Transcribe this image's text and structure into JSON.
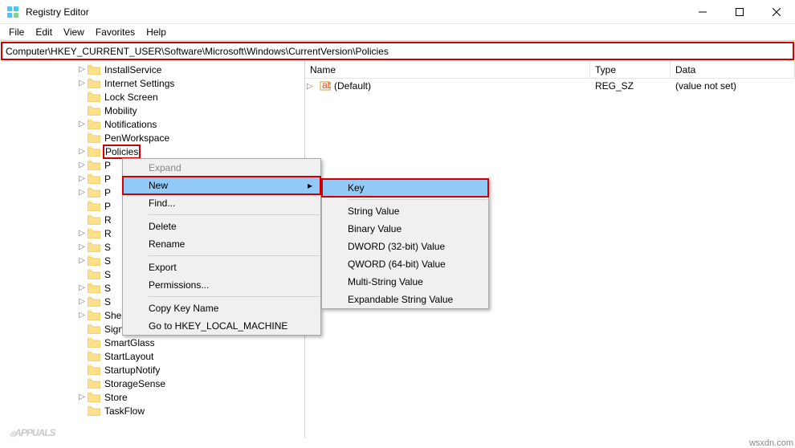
{
  "window": {
    "title": "Registry Editor"
  },
  "menu": [
    "File",
    "Edit",
    "View",
    "Favorites",
    "Help"
  ],
  "address": "Computer\\HKEY_CURRENT_USER\\Software\\Microsoft\\Windows\\CurrentVersion\\Policies",
  "tree": [
    {
      "indent": 95,
      "exp": ">",
      "label": "InstallService"
    },
    {
      "indent": 95,
      "exp": ">",
      "label": "Internet Settings"
    },
    {
      "indent": 95,
      "exp": "",
      "label": "Lock Screen"
    },
    {
      "indent": 95,
      "exp": "",
      "label": "Mobility"
    },
    {
      "indent": 95,
      "exp": ">",
      "label": "Notifications"
    },
    {
      "indent": 95,
      "exp": "",
      "label": "PenWorkspace"
    },
    {
      "indent": 95,
      "exp": ">",
      "label": "Policies",
      "hl": true
    },
    {
      "indent": 95,
      "exp": ">",
      "label": "P"
    },
    {
      "indent": 95,
      "exp": ">",
      "label": "P"
    },
    {
      "indent": 95,
      "exp": ">",
      "label": "P"
    },
    {
      "indent": 95,
      "exp": "",
      "label": "P"
    },
    {
      "indent": 95,
      "exp": "",
      "label": "R"
    },
    {
      "indent": 95,
      "exp": ">",
      "label": "R"
    },
    {
      "indent": 95,
      "exp": ">",
      "label": "S"
    },
    {
      "indent": 95,
      "exp": ">",
      "label": "S"
    },
    {
      "indent": 95,
      "exp": "",
      "label": "S"
    },
    {
      "indent": 95,
      "exp": ">",
      "label": "S"
    },
    {
      "indent": 95,
      "exp": ">",
      "label": "S"
    },
    {
      "indent": 95,
      "exp": ">",
      "label": "Shell Extensions"
    },
    {
      "indent": 95,
      "exp": "",
      "label": "SignalManager"
    },
    {
      "indent": 95,
      "exp": "",
      "label": "SmartGlass"
    },
    {
      "indent": 95,
      "exp": "",
      "label": "StartLayout"
    },
    {
      "indent": 95,
      "exp": "",
      "label": "StartupNotify"
    },
    {
      "indent": 95,
      "exp": "",
      "label": "StorageSense"
    },
    {
      "indent": 95,
      "exp": ">",
      "label": "Store"
    },
    {
      "indent": 95,
      "exp": "",
      "label": "TaskFlow"
    }
  ],
  "columns": {
    "name": "Name",
    "type": "Type",
    "data": "Data"
  },
  "values": [
    {
      "name": "(Default)",
      "type": "REG_SZ",
      "data": "(value not set)"
    }
  ],
  "context1": [
    {
      "label": "Expand",
      "kind": "dis"
    },
    {
      "label": "New",
      "kind": "sel hl",
      "arrow": true
    },
    {
      "label": "Find...",
      "kind": ""
    },
    {
      "sep": true
    },
    {
      "label": "Delete",
      "kind": ""
    },
    {
      "label": "Rename",
      "kind": ""
    },
    {
      "sep": true
    },
    {
      "label": "Export",
      "kind": ""
    },
    {
      "label": "Permissions...",
      "kind": ""
    },
    {
      "sep": true
    },
    {
      "label": "Copy Key Name",
      "kind": ""
    },
    {
      "label": "Go to HKEY_LOCAL_MACHINE",
      "kind": ""
    }
  ],
  "context2": [
    {
      "label": "Key",
      "kind": "sel hl"
    },
    {
      "sep": true
    },
    {
      "label": "String Value",
      "kind": ""
    },
    {
      "label": "Binary Value",
      "kind": ""
    },
    {
      "label": "DWORD (32-bit) Value",
      "kind": ""
    },
    {
      "label": "QWORD (64-bit) Value",
      "kind": ""
    },
    {
      "label": "Multi-String Value",
      "kind": ""
    },
    {
      "label": "Expandable String Value",
      "kind": ""
    }
  ],
  "status": "wsxdn.com",
  "watermark": "APPUALS"
}
